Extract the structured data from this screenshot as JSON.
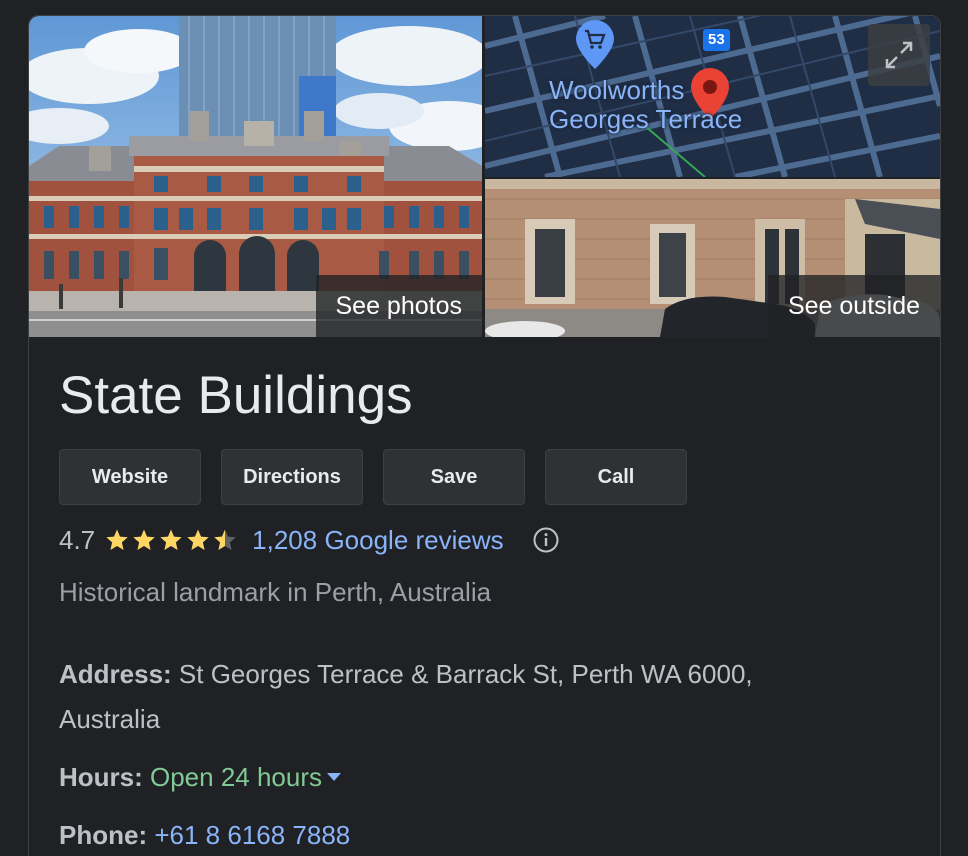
{
  "place": {
    "name": "State Buildings",
    "rating": "4.7",
    "rating_value": 4.7,
    "reviews_text": "1,208 Google reviews",
    "category": "Historical landmark in Perth, Australia"
  },
  "media": {
    "photos_label": "See photos",
    "outside_label": "See outside",
    "map": {
      "label_1": "Woolworths",
      "label_2": "Georges Terrace",
      "route_badge": "53",
      "icons": [
        "shopping-cart-icon",
        "map-pin-icon",
        "expand-icon"
      ]
    }
  },
  "actions": [
    {
      "label": "Website"
    },
    {
      "label": "Directions"
    },
    {
      "label": "Save"
    },
    {
      "label": "Call"
    }
  ],
  "details": {
    "address_label": "Address:",
    "address_value": "St Georges Terrace & Barrack St, Perth WA 6000, Australia",
    "hours_label": "Hours:",
    "hours_value": "Open 24 hours",
    "phone_label": "Phone:",
    "phone_value": "+61 8 6168 7888"
  },
  "colors": {
    "background": "#202124",
    "title": "#e8eaed",
    "link": "#8ab4f8",
    "open": "#81c995",
    "star": "#fdd663"
  }
}
